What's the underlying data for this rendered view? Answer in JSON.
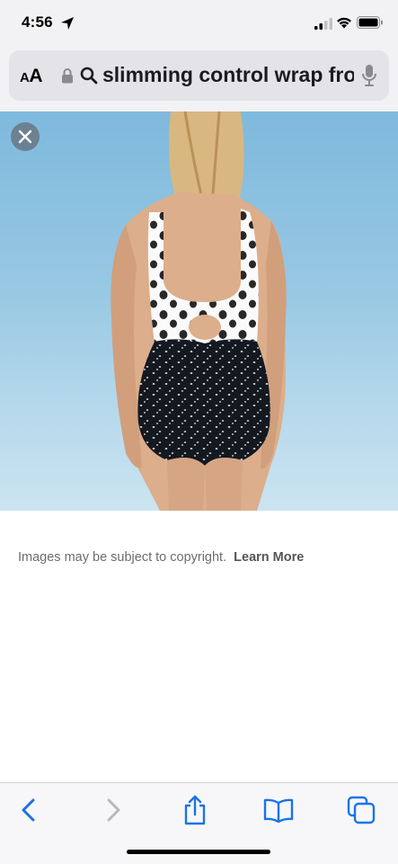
{
  "status": {
    "time": "4:56",
    "icons": [
      "location-arrow-icon",
      "cellular-signal-icon",
      "wifi-icon",
      "battery-icon"
    ]
  },
  "address_bar": {
    "aa_label_small": "A",
    "aa_label_large": "A",
    "url_text": "slimming control wrap front",
    "icons": [
      "lock-icon",
      "search-icon",
      "microphone-icon"
    ]
  },
  "image_viewer": {
    "close_icon": "close-icon"
  },
  "caption": {
    "text": "Images may be subject to copyright.",
    "link": "Learn More"
  },
  "toolbar": {
    "buttons": [
      "back-icon",
      "forward-icon",
      "share-icon",
      "bookmarks-icon",
      "tabs-icon"
    ]
  },
  "colors": {
    "accent": "#1a73e8",
    "disabled": "#b9b9bd"
  }
}
